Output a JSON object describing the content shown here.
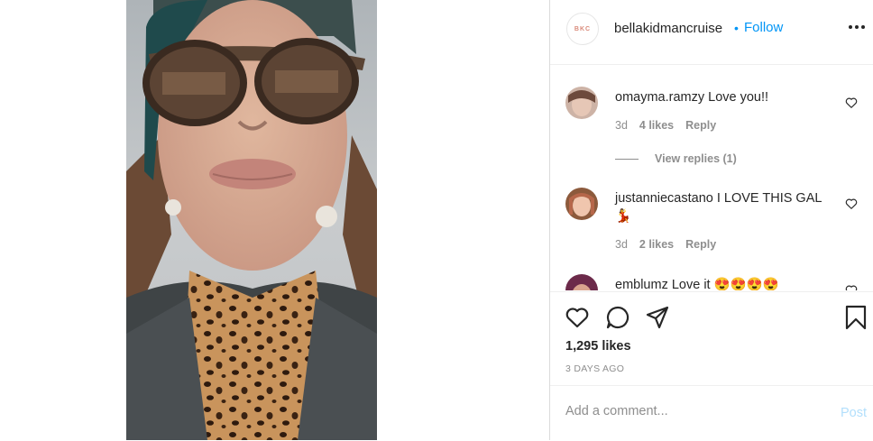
{
  "post": {
    "author": "bellakidmancruise",
    "brand_avatar_text": "BKC",
    "follow_label": "Follow",
    "separator": "•"
  },
  "comments": [
    {
      "user": "omayma.ramzy",
      "text": "Love you!!",
      "time": "3d",
      "likes": "4 likes",
      "reply": "Reply"
    },
    {
      "user": "justanniecastano",
      "text": "I LOVE THIS GAL 💃",
      "time": "3d",
      "likes": "2 likes",
      "reply": "Reply"
    },
    {
      "user": "emblumz",
      "text": "Love it 😍😍😍😍"
    }
  ],
  "view_replies": "View replies (1)",
  "likes_count": "1,295 likes",
  "timestamp": "3 DAYS AGO",
  "add_comment": {
    "placeholder": "Add a comment...",
    "post_label": "Post"
  },
  "colors": {
    "accent": "#0095f6",
    "post_disabled": "#b2dffc",
    "text": "#262626",
    "muted": "#8e8e8e",
    "border": "#dbdbdb"
  },
  "icons": [
    "more-icon",
    "heart-icon",
    "comment-icon",
    "share-icon",
    "bookmark-icon"
  ]
}
